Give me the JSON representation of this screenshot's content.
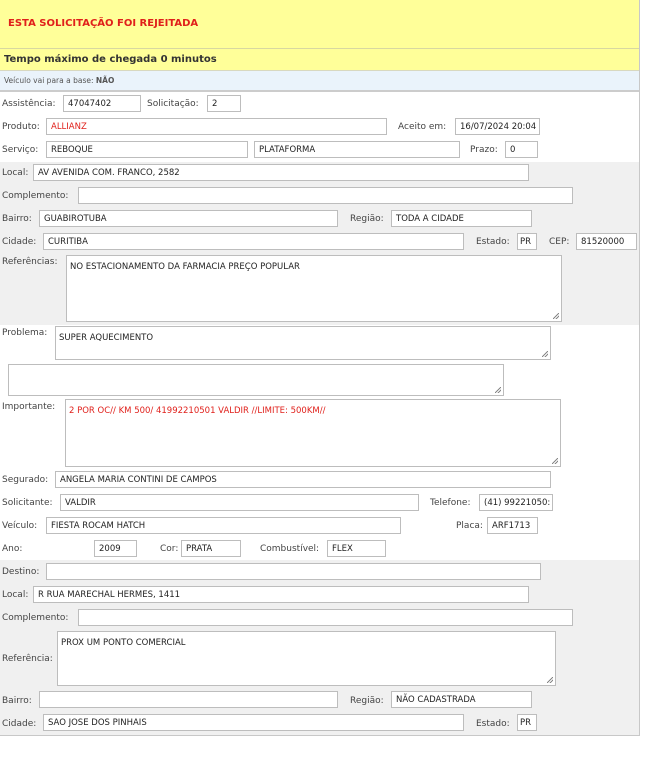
{
  "alert": {
    "title": "ESTA SOLICITAÇÃO FOI REJEITADA",
    "tempo": "Tempo máximo de chegada 0 minutos",
    "base_label": "Veículo vai para a base:",
    "base_value": "NÃO"
  },
  "colors": {
    "header_bg": "#ffff99",
    "alert_text": "#e0201b",
    "info_bg": "#eaf3fb",
    "section_bg": "#f0f0f0"
  },
  "atendimento": {
    "assistencia": {
      "label": "Assistência:",
      "value": "47047402"
    },
    "solicitacao": {
      "label": "Solicitação:",
      "value": "2"
    },
    "produto": {
      "label": "Produto:",
      "value": "ALLIANZ"
    },
    "aceito": {
      "label": "Aceito em:",
      "value": "16/07/2024 20:04"
    },
    "servico": {
      "label": "Serviço:",
      "value": "REBOQUE",
      "tipo": "PLATAFORMA"
    },
    "prazo": {
      "label": "Prazo:",
      "value": "0"
    }
  },
  "origem": {
    "local": {
      "label": "Local:",
      "value": "AV AVENIDA COM. FRANCO, 2582"
    },
    "complemento": {
      "label": "Complemento:",
      "value": ""
    },
    "bairro": {
      "label": "Bairro:",
      "value": "GUABIROTUBA"
    },
    "regiao": {
      "label": "Região:",
      "value": "TODA A CIDADE"
    },
    "cidade": {
      "label": "Cidade:",
      "value": "CURITIBA"
    },
    "estado": {
      "label": "Estado:",
      "value": "PR"
    },
    "cep": {
      "label": "CEP:",
      "value": "81520000"
    },
    "referencias": {
      "label": "Referências:",
      "value": "NO ESTACIONAMENTO DA FARMACIA  PREÇO POPULAR"
    }
  },
  "detalhes": {
    "problema": {
      "label": "Problema:",
      "value": "SUPER AQUECIMENTO",
      "extra": ""
    },
    "importante": {
      "label": "Importante:",
      "value": "2 POR OC// KM 500/ 41992210501 VALDIR  //LIMITE: 500KM//"
    },
    "segurado": {
      "label": "Segurado:",
      "value": "ANGELA MARIA CONTINI DE CAMPOS"
    },
    "solicitante": {
      "label": "Solicitante:",
      "value": "VALDIR"
    },
    "telefone": {
      "label": "Telefone:",
      "value": "(41) 99221050:"
    },
    "veiculo": {
      "label": "Veículo:",
      "value": "FIESTA ROCAM HATCH"
    },
    "placa": {
      "label": "Placa:",
      "value": "ARF1713"
    },
    "ano": {
      "label": "Ano:",
      "value": "2009"
    },
    "cor": {
      "label": "Cor:",
      "value": "PRATA"
    },
    "combustivel": {
      "label": "Combustível:",
      "value": "FLEX"
    }
  },
  "destino": {
    "destino": {
      "label": "Destino:",
      "value": ""
    },
    "local": {
      "label": "Local:",
      "value": "R RUA MARECHAL HERMES, 1411"
    },
    "complemento": {
      "label": "Complemento:",
      "value": ""
    },
    "referencia": {
      "label": "Referência:",
      "value": "PROX UM PONTO COMERCIAL"
    },
    "bairro": {
      "label": "Bairro:",
      "value": ""
    },
    "regiao": {
      "label": "Região:",
      "value": "NÃO CADASTRADA"
    },
    "cidade": {
      "label": "Cidade:",
      "value": "SAO JOSE DOS PINHAIS"
    },
    "estado": {
      "label": "Estado:",
      "value": "PR"
    }
  }
}
